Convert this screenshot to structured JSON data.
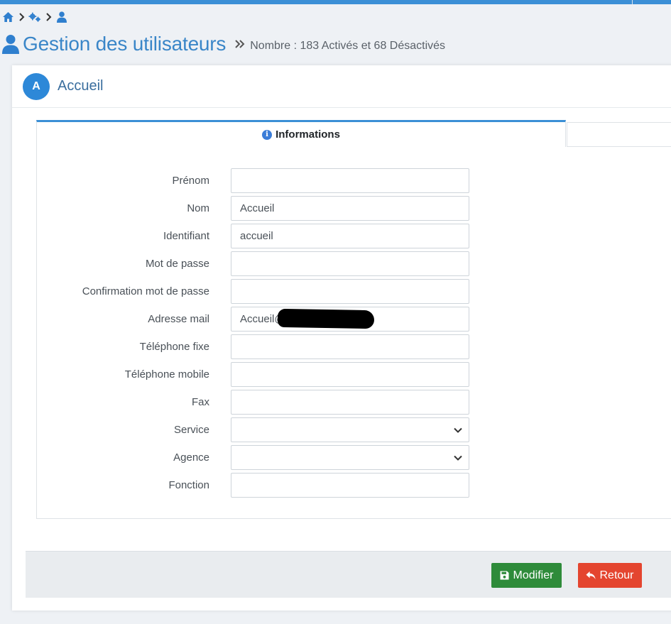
{
  "colors": {
    "accent": "#3b8fd6",
    "title": "#3a86c8",
    "save": "#2e8b3a",
    "back": "#e4452f"
  },
  "breadcrumb": {
    "icons": [
      "home-icon",
      "cogs-icon",
      "user-icon"
    ]
  },
  "header": {
    "title": "Gestion des utilisateurs",
    "count_text": "Nombre : 183 Activés et 68 Désactivés"
  },
  "card": {
    "avatar_letter": "A",
    "title": "Accueil"
  },
  "tabs": {
    "active_label": "Informations"
  },
  "form": {
    "prenom": {
      "label": "Prénom",
      "value": ""
    },
    "nom": {
      "label": "Nom",
      "value": "Accueil"
    },
    "identifiant": {
      "label": "Identifiant",
      "value": "accueil"
    },
    "mot_de_passe": {
      "label": "Mot de passe",
      "value": ""
    },
    "confirmation": {
      "label": "Confirmation mot de passe",
      "value": ""
    },
    "email": {
      "label": "Adresse mail",
      "value": "Accueil@"
    },
    "tel_fixe": {
      "label": "Téléphone fixe",
      "value": ""
    },
    "tel_mobile": {
      "label": "Téléphone mobile",
      "value": ""
    },
    "fax": {
      "label": "Fax",
      "value": ""
    },
    "service": {
      "label": "Service",
      "value": ""
    },
    "agence": {
      "label": "Agence",
      "value": ""
    },
    "fonction": {
      "label": "Fonction",
      "value": ""
    }
  },
  "footer": {
    "save_label": "Modifier",
    "back_label": "Retour"
  }
}
